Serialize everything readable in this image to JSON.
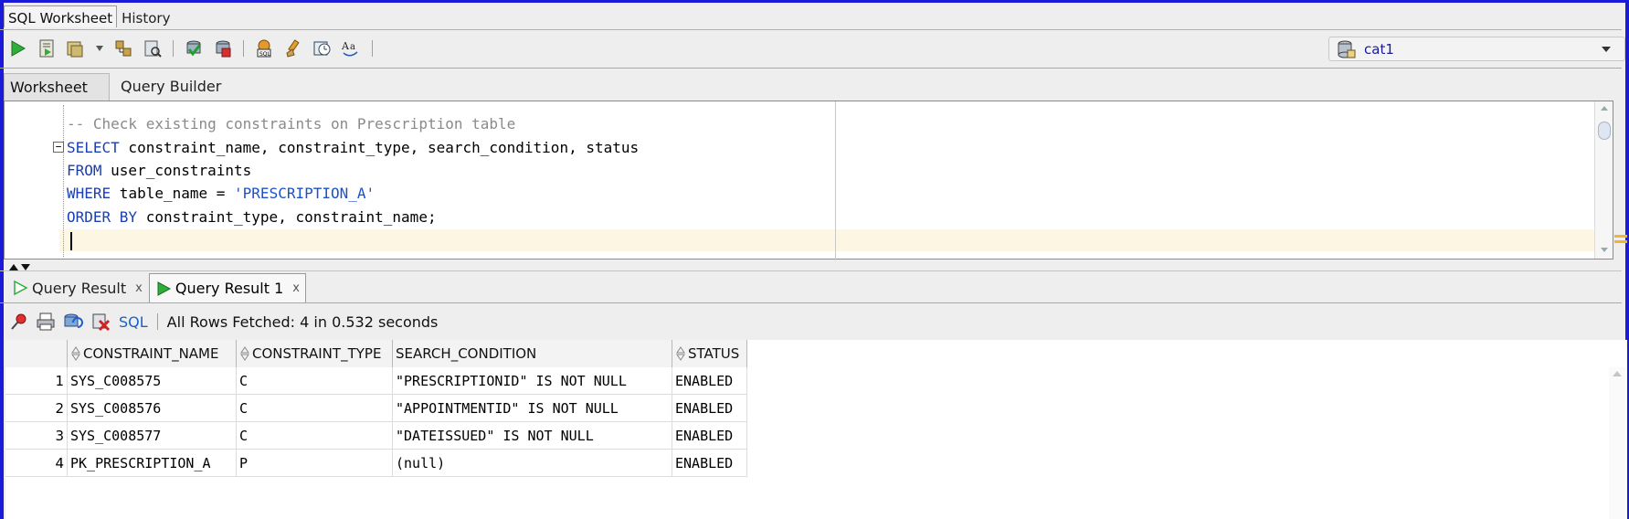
{
  "top_tabs": [
    "SQL Worksheet",
    "History"
  ],
  "connection": {
    "label": "cat1"
  },
  "worksheet_tabs": [
    "Worksheet",
    "Query Builder"
  ],
  "editor": {
    "comment": "-- Check existing constraints on Prescription table",
    "line1_kw": "SELECT",
    "line1_rest": " constraint_name, constraint_type, search_condition, status",
    "line2_kw": "FROM",
    "line2_rest": " user_constraints",
    "line3_kw": "WHERE",
    "line3_mid": " table_name = ",
    "line3_str": "'PRESCRIPTION_A'",
    "line4_kw": "ORDER BY",
    "line4_rest": " constraint_type, constraint_name;"
  },
  "result_tabs": [
    {
      "label": "Query Result",
      "close": "x"
    },
    {
      "label": "Query Result 1",
      "close": "x"
    }
  ],
  "result_toolbar": {
    "sql": "SQL",
    "status": "All Rows Fetched: 4 in 0.532 seconds"
  },
  "grid": {
    "columns": [
      "CONSTRAINT_NAME",
      "CONSTRAINT_TYPE",
      "SEARCH_CONDITION",
      "STATUS"
    ],
    "rows": [
      {
        "n": "1",
        "cells": [
          "SYS_C008575",
          "C",
          "\"PRESCRIPTIONID\" IS NOT NULL",
          "ENABLED"
        ]
      },
      {
        "n": "2",
        "cells": [
          "SYS_C008576",
          "C",
          "\"APPOINTMENTID\" IS NOT NULL",
          "ENABLED"
        ]
      },
      {
        "n": "3",
        "cells": [
          "SYS_C008577",
          "C",
          "\"DATEISSUED\" IS NOT NULL",
          "ENABLED"
        ]
      },
      {
        "n": "4",
        "cells": [
          "PK_PRESCRIPTION_A",
          "P",
          "(null)",
          "ENABLED"
        ]
      }
    ]
  },
  "colors": {
    "window_border": "#1a1ad8",
    "keyword": "#1c3fb0",
    "comment": "#8a8a8a",
    "current_line": "#fdf6e3"
  }
}
